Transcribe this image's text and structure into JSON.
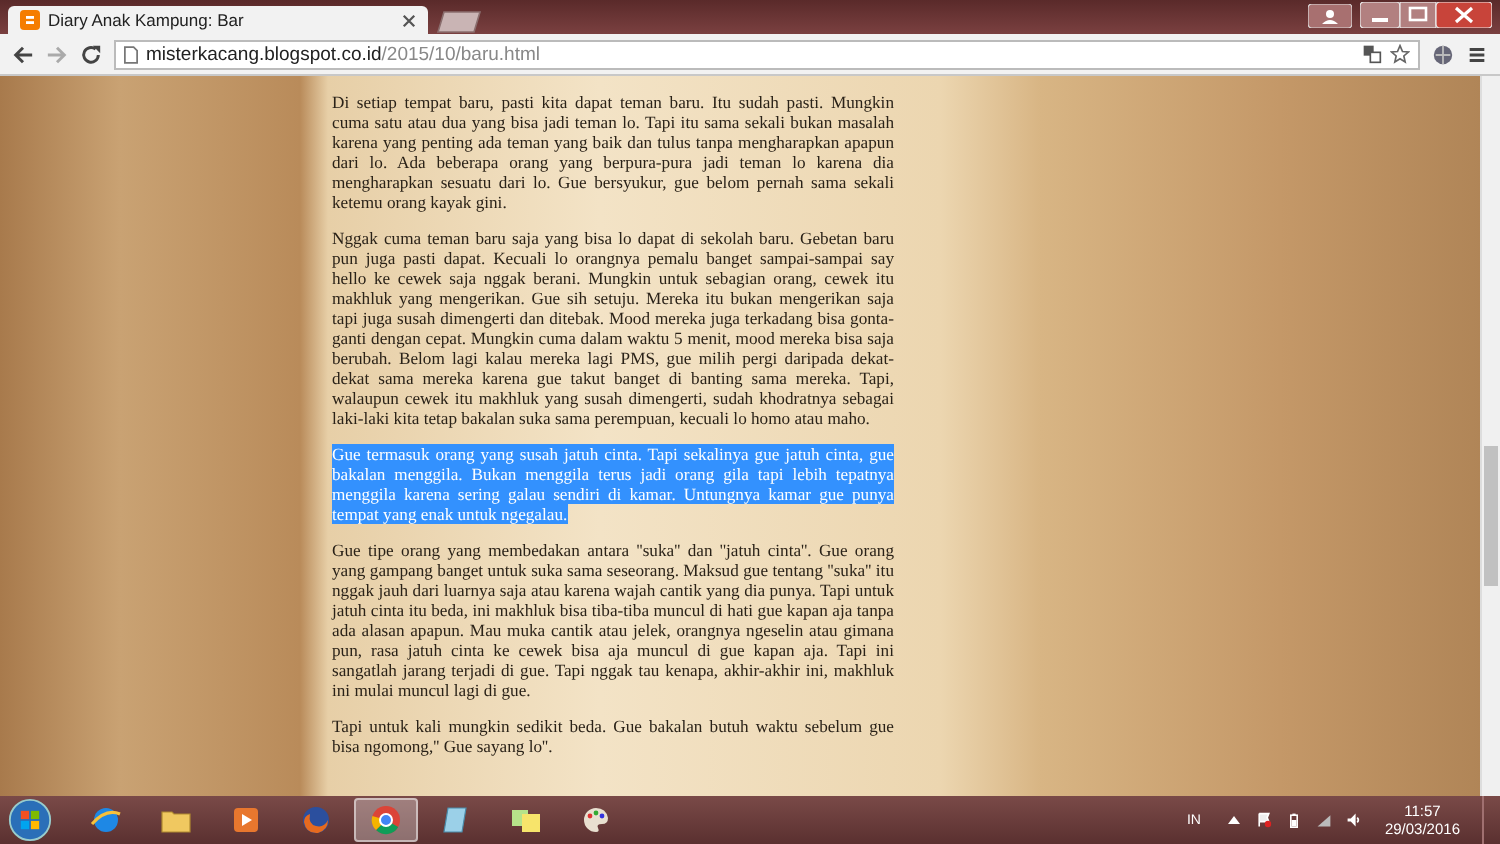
{
  "browser": {
    "tabs": [
      {
        "title": "Diary Anak Kampung: Bar",
        "selected": true
      }
    ],
    "address": {
      "domain": "misterkacang.blogspot.co.id",
      "path": "/2015/10/baru.html"
    }
  },
  "article": {
    "paragraphs": [
      {
        "text": "Di setiap tempat baru, pasti kita dapat teman baru. Itu sudah pasti. Mungkin cuma satu atau dua yang bisa jadi teman lo. Tapi itu sama sekali bukan masalah karena yang penting ada teman yang baik dan tulus tanpa mengharapkan apapun dari lo. Ada beberapa orang yang berpura-pura jadi teman lo karena dia mengharapkan sesuatu dari lo. Gue bersyukur, gue belom pernah sama sekali ketemu orang kayak gini.",
        "selected": false
      },
      {
        "text": "Nggak cuma teman baru saja yang bisa lo dapat di sekolah baru. Gebetan baru pun juga pasti dapat. Kecuali lo orangnya pemalu banget sampai-sampai say hello ke cewek saja nggak berani. Mungkin untuk sebagian orang, cewek itu makhluk yang mengerikan. Gue sih setuju. Mereka itu bukan mengerikan saja tapi juga susah dimengerti dan ditebak. Mood mereka juga terkadang bisa gonta-ganti dengan cepat. Mungkin cuma dalam waktu 5 menit, mood mereka bisa saja berubah. Belom lagi kalau mereka lagi PMS, gue milih pergi daripada dekat-dekat sama mereka karena gue takut banget di banting sama mereka. Tapi, walaupun cewek itu makhluk yang susah dimengerti, sudah khodratnya sebagai laki-laki kita tetap bakalan suka sama perempuan, kecuali lo homo atau maho.",
        "selected": false
      },
      {
        "text": "Gue termasuk orang yang susah jatuh cinta. Tapi sekalinya gue jatuh cinta, gue bakalan menggila. Bukan menggila terus jadi orang gila tapi lebih tepatnya menggila karena sering galau sendiri di kamar. Untungnya kamar gue punya tempat yang enak untuk ngegalau.",
        "selected": true
      },
      {
        "text": "Gue tipe orang yang membedakan antara ''suka'' dan ''jatuh cinta''. Gue orang yang gampang banget untuk suka sama seseorang. Maksud gue tentang ''suka'' itu nggak jauh dari luarnya saja atau karena wajah cantik yang dia punya. Tapi untuk jatuh cinta itu beda, ini makhluk bisa tiba-tiba muncul di hati gue kapan aja tanpa ada alasan apapun. Mau muka cantik atau jelek, orangnya ngeselin atau gimana pun, rasa jatuh cinta ke cewek bisa aja muncul di gue kapan aja. Tapi ini sangatlah jarang terjadi di gue. Tapi nggak tau kenapa, akhir-akhir ini, makhluk ini mulai muncul lagi di gue.",
        "selected": false
      },
      {
        "text": "Tapi untuk kali mungkin sedikit beda. Gue bakalan butuh waktu sebelum gue bisa ngomong,'' Gue sayang lo''.",
        "selected": false
      }
    ]
  },
  "taskbar": {
    "apps": [
      {
        "kind": "e-logo",
        "selected": false
      },
      {
        "kind": "folder",
        "selected": false
      },
      {
        "kind": "play",
        "selected": false
      },
      {
        "kind": "fox",
        "selected": false
      },
      {
        "kind": "ring",
        "selected": true
      },
      {
        "kind": "notepad",
        "selected": false
      },
      {
        "kind": "notes",
        "selected": false
      },
      {
        "kind": "palette",
        "selected": false
      }
    ],
    "language": "IN",
    "time": "11:57",
    "date": "29/03/2016"
  }
}
